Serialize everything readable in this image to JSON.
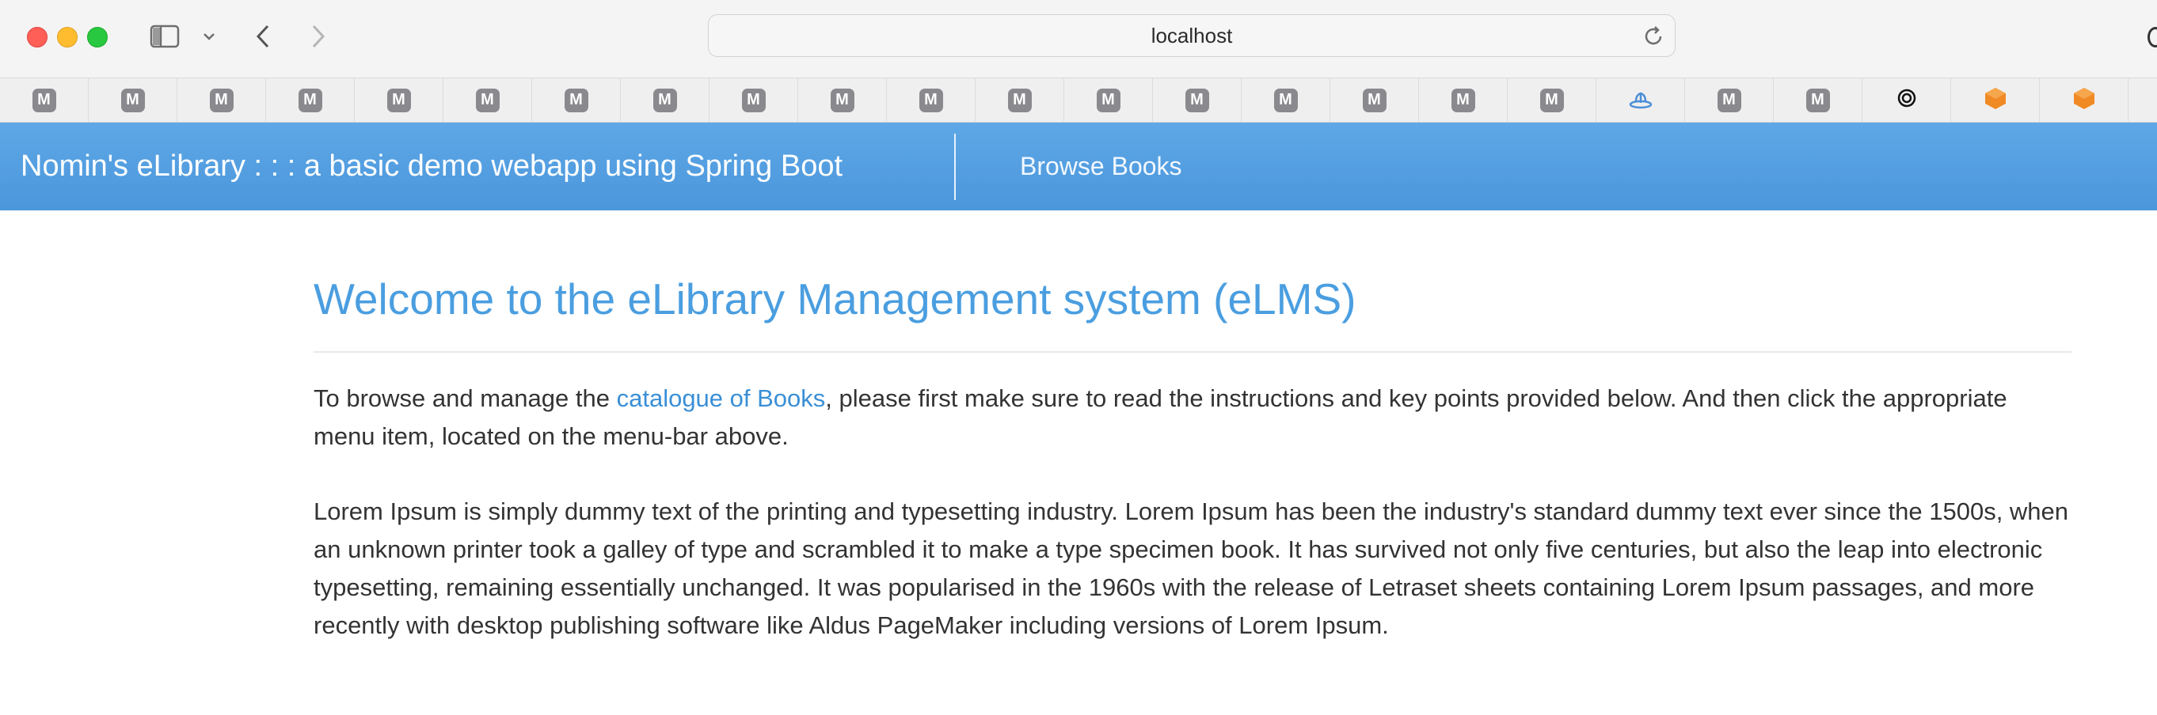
{
  "browser": {
    "url": "localhost",
    "bookmarks": [
      "M",
      "M",
      "M",
      "M",
      "M",
      "M",
      "M",
      "M",
      "M",
      "M",
      "M",
      "M",
      "M",
      "M",
      "M",
      "M",
      "M",
      "M",
      "",
      "M",
      "M",
      "",
      "",
      ""
    ]
  },
  "navbar": {
    "brand": "Nomin's eLibrary : : : a basic demo webapp using Spring Boot",
    "browse_link": "Browse Books",
    "bg_color": "#4b96dc"
  },
  "main": {
    "heading": "Welcome to the eLibrary Management system (eLMS)",
    "intro_before": "To browse and manage the ",
    "intro_link": "catalogue of Books",
    "intro_after": ", please first make sure to read the instructions and key points provided below. And then click the appropriate menu item, located on the menu-bar above.",
    "lorem": "Lorem Ipsum is simply dummy text of the printing and typesetting industry. Lorem Ipsum has been the industry's standard dummy text ever since the 1500s, when an unknown printer took a galley of type and scrambled it to make a type specimen book. It has survived not only five centuries, but also the leap into electronic typesetting, remaining essentially unchanged. It was popularised in the 1960s with the release of Letraset sheets containing Lorem Ipsum passages, and more recently with desktop publishing software like Aldus PageMaker including versions of Lorem Ipsum."
  }
}
